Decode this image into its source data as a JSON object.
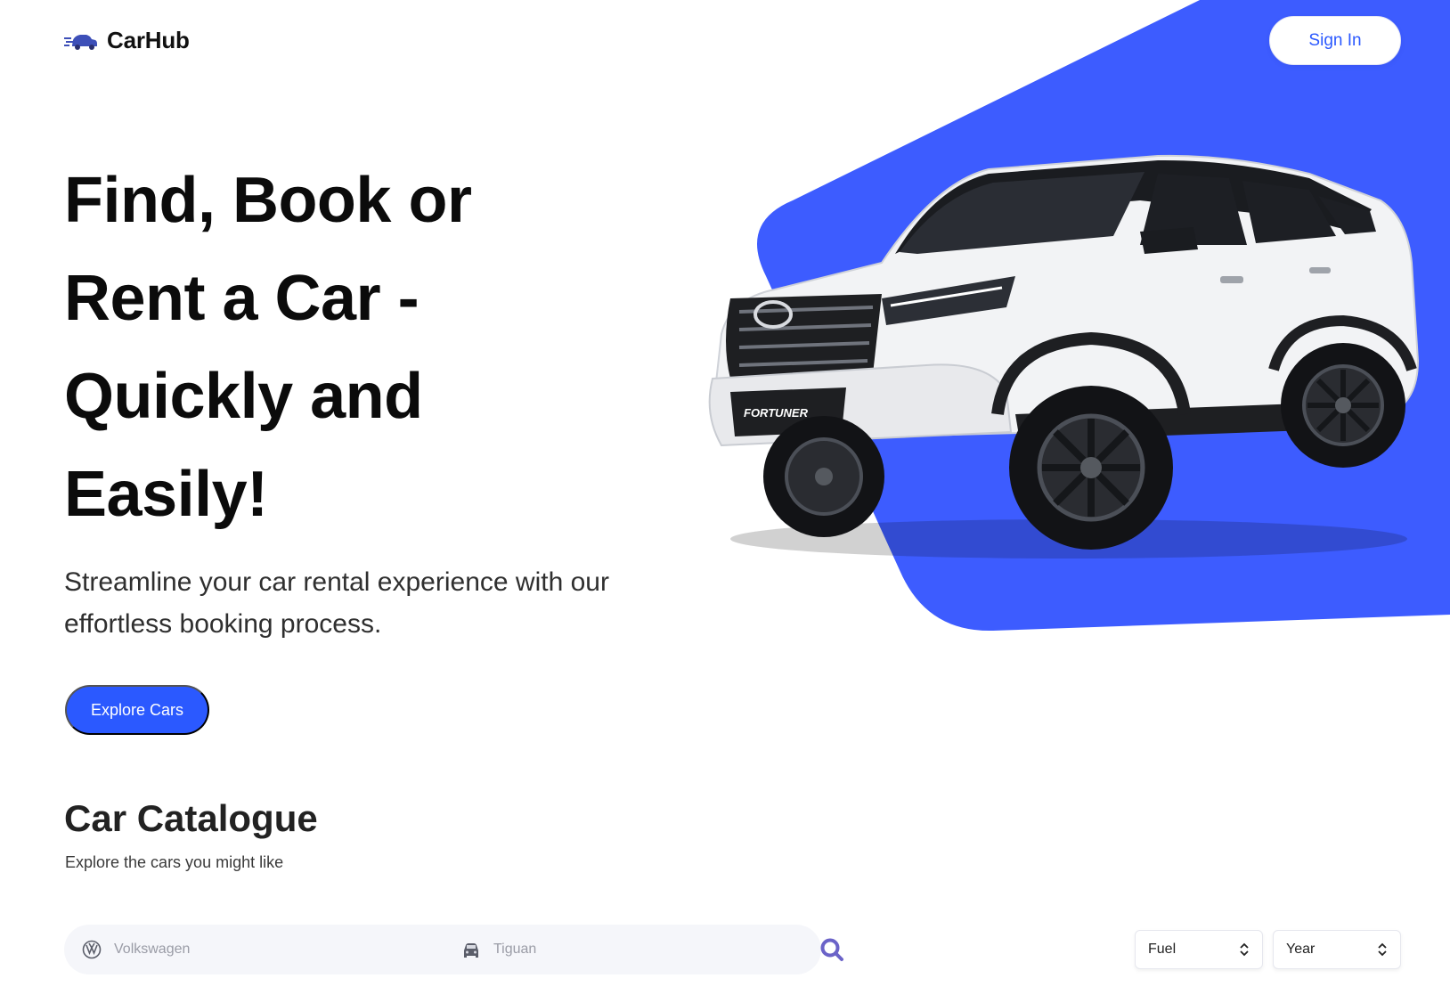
{
  "brand": {
    "name": "CarHub",
    "icon": "car-logo-icon"
  },
  "nav": {
    "signin_label": "Sign In"
  },
  "hero": {
    "headline": "Find, Book or Rent a Car - Quickly and Easily!",
    "subtitle": "Streamline your car rental experience with our effortless booking process.",
    "cta_label": "Explore Cars",
    "image": "white-suv-image",
    "accent_color": "#3D5CFF"
  },
  "catalogue": {
    "title": "Car Catalogue",
    "subtitle": "Explore the cars you might like"
  },
  "search": {
    "make_placeholder": "Volkswagen",
    "make_icon": "volkswagen-logo-icon",
    "model_placeholder": "Tiguan",
    "model_icon": "car-front-icon",
    "submit_icon": "magnifier-icon"
  },
  "filters": {
    "fuel": {
      "label": "Fuel",
      "icon": "updown-chevron-icon"
    },
    "year": {
      "label": "Year",
      "icon": "updown-chevron-icon"
    }
  },
  "colors": {
    "primary": "#2B59FF",
    "text": "#111111",
    "muted": "#9A9CA6",
    "search_bg": "#F5F6FA"
  }
}
